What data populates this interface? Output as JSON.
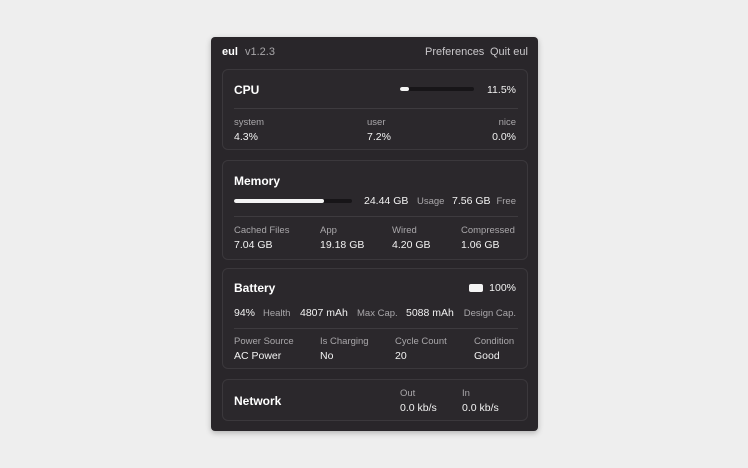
{
  "header": {
    "app_name": "eul",
    "version": "v1.2.3",
    "preferences": "Preferences",
    "quit": "Quit eul"
  },
  "cpu": {
    "title": "CPU",
    "usage_percent": "11.5%",
    "usage_fraction": 0.115,
    "stats": [
      {
        "label": "system",
        "value": "4.3%"
      },
      {
        "label": "user",
        "value": "7.2%"
      },
      {
        "label": "nice",
        "value": "0.0%"
      }
    ]
  },
  "memory": {
    "title": "Memory",
    "usage_fraction": 0.76,
    "used_value": "24.44 GB",
    "used_label": "Usage",
    "free_value": "7.56 GB",
    "free_label": "Free",
    "stats": [
      {
        "label": "Cached Files",
        "value": "7.04 GB"
      },
      {
        "label": "App",
        "value": "19.18 GB"
      },
      {
        "label": "Wired",
        "value": "4.20 GB"
      },
      {
        "label": "Compressed",
        "value": "1.06 GB"
      }
    ]
  },
  "battery": {
    "title": "Battery",
    "level": "100%",
    "level_fraction": 1.0,
    "icon": "battery-full-icon",
    "health_value": "94%",
    "health_label": "Health",
    "max_cap_value": "4807 mAh",
    "max_cap_label": "Max Cap.",
    "design_cap_value": "5088 mAh",
    "design_cap_label": "Design Cap.",
    "stats": [
      {
        "label": "Power Source",
        "value": "AC Power"
      },
      {
        "label": "Is Charging",
        "value": "No"
      },
      {
        "label": "Cycle Count",
        "value": "20"
      },
      {
        "label": "Condition",
        "value": "Good"
      }
    ]
  },
  "network": {
    "title": "Network",
    "out_label": "Out",
    "out_value": "0.0 kb/s",
    "in_label": "In",
    "in_value": "0.0 kb/s"
  },
  "colors": {
    "panel_bg": "#29262a",
    "card_bg": "#2b282c",
    "bar_fill": "#f4f4f4",
    "page_bg": "#eeeeee"
  }
}
